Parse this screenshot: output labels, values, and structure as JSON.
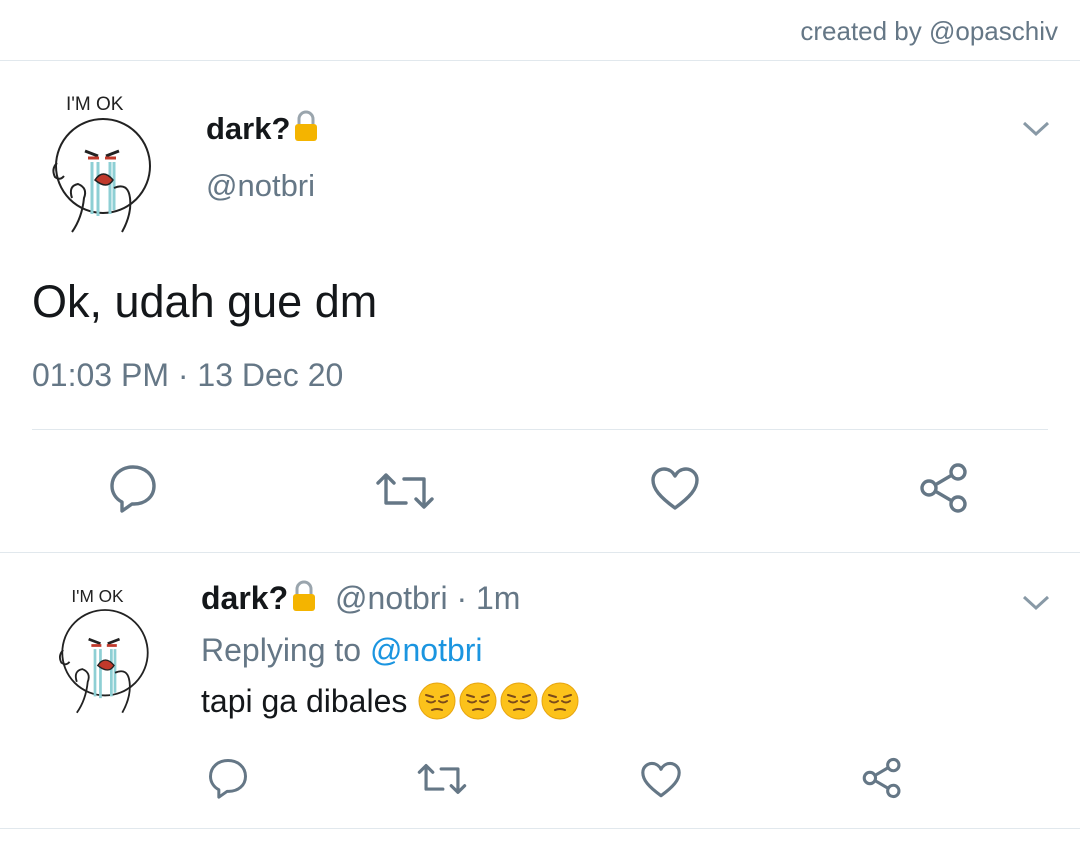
{
  "header": {
    "credit": "created by @opaschiv"
  },
  "tweet": {
    "avatar_caption": "I'M OK",
    "display_name": "dark?",
    "handle": "@notbri",
    "text": "Ok, udah gue dm",
    "timestamp": "01:03 PM · 13 Dec 20",
    "actions": [
      "reply-icon",
      "retweet-icon",
      "like-icon",
      "share-icon"
    ]
  },
  "reply": {
    "avatar_caption": "I'M OK",
    "display_name": "dark?",
    "handle": "@notbri",
    "time": "· 1m",
    "replying_label": "Replying to",
    "replying_to": "@notbri",
    "text": "tapi ga dibales",
    "emoji": [
      "pensive-face",
      "pensive-face",
      "pensive-face",
      "pensive-face"
    ],
    "actions": [
      "reply-icon",
      "retweet-icon",
      "like-icon",
      "share-icon"
    ]
  },
  "colors": {
    "text": "#14171a",
    "secondary": "#657786",
    "link": "#1b95e0",
    "divider": "#e1e8ed",
    "lock": "#f4b400"
  }
}
